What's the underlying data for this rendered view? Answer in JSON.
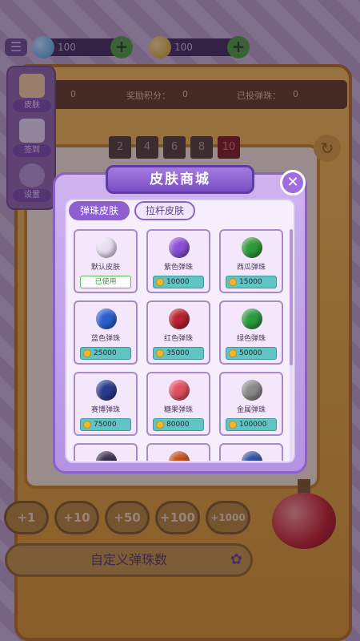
{
  "top_bar": {
    "gems": "100",
    "coins": "100"
  },
  "stats": {
    "left_value": "0",
    "reward_label": "奖励积分：",
    "reward_value": "0",
    "balls_label": "已投弹珠：",
    "balls_value": "0"
  },
  "side_menu": [
    {
      "label": "皮肤",
      "icon": "palette-icon"
    },
    {
      "label": "签到",
      "icon": "calendar-check-icon"
    },
    {
      "label": "设置",
      "icon": "gear-icon"
    }
  ],
  "number_row": [
    "2",
    "4",
    "6",
    "8",
    "10"
  ],
  "bet_buttons": [
    "+1",
    "+10",
    "+50",
    "+100",
    "+1000"
  ],
  "custom_button": "自定义弹珠数",
  "modal": {
    "title": "皮肤商城",
    "close": "✕",
    "tabs": [
      {
        "label": "弹珠皮肤",
        "active": true
      },
      {
        "label": "拉杆皮肤",
        "active": false
      }
    ],
    "items": [
      {
        "name": "默认皮肤",
        "status": "已使用",
        "color": "#e8e0f2"
      },
      {
        "name": "紫色弹珠",
        "price": "10000",
        "color": "#8b4fd6"
      },
      {
        "name": "西瓜弹珠",
        "price": "15000",
        "color": "#2f9a3a"
      },
      {
        "name": "蓝色弹珠",
        "price": "25000",
        "color": "#2b5fd0"
      },
      {
        "name": "红色弹珠",
        "price": "35000",
        "color": "#b82030"
      },
      {
        "name": "绿色弹珠",
        "price": "50000",
        "color": "#2a9a3f"
      },
      {
        "name": "赛博弹珠",
        "price": "75000",
        "color": "#2a3a8a"
      },
      {
        "name": "糖果弹珠",
        "price": "80000",
        "color": "#e05060"
      },
      {
        "name": "金属弹珠",
        "price": "100000",
        "color": "#8a8a8a"
      }
    ],
    "partial_items": [
      {
        "color": "#3a3050"
      },
      {
        "color": "#c0501a"
      },
      {
        "color": "#3050a0"
      }
    ]
  },
  "colors": {
    "modal_purple": "#b592e4",
    "active_tab": "#8d5fd1",
    "price_badge": "#60c3c4",
    "used_badge_text": "#3a9a3a"
  }
}
